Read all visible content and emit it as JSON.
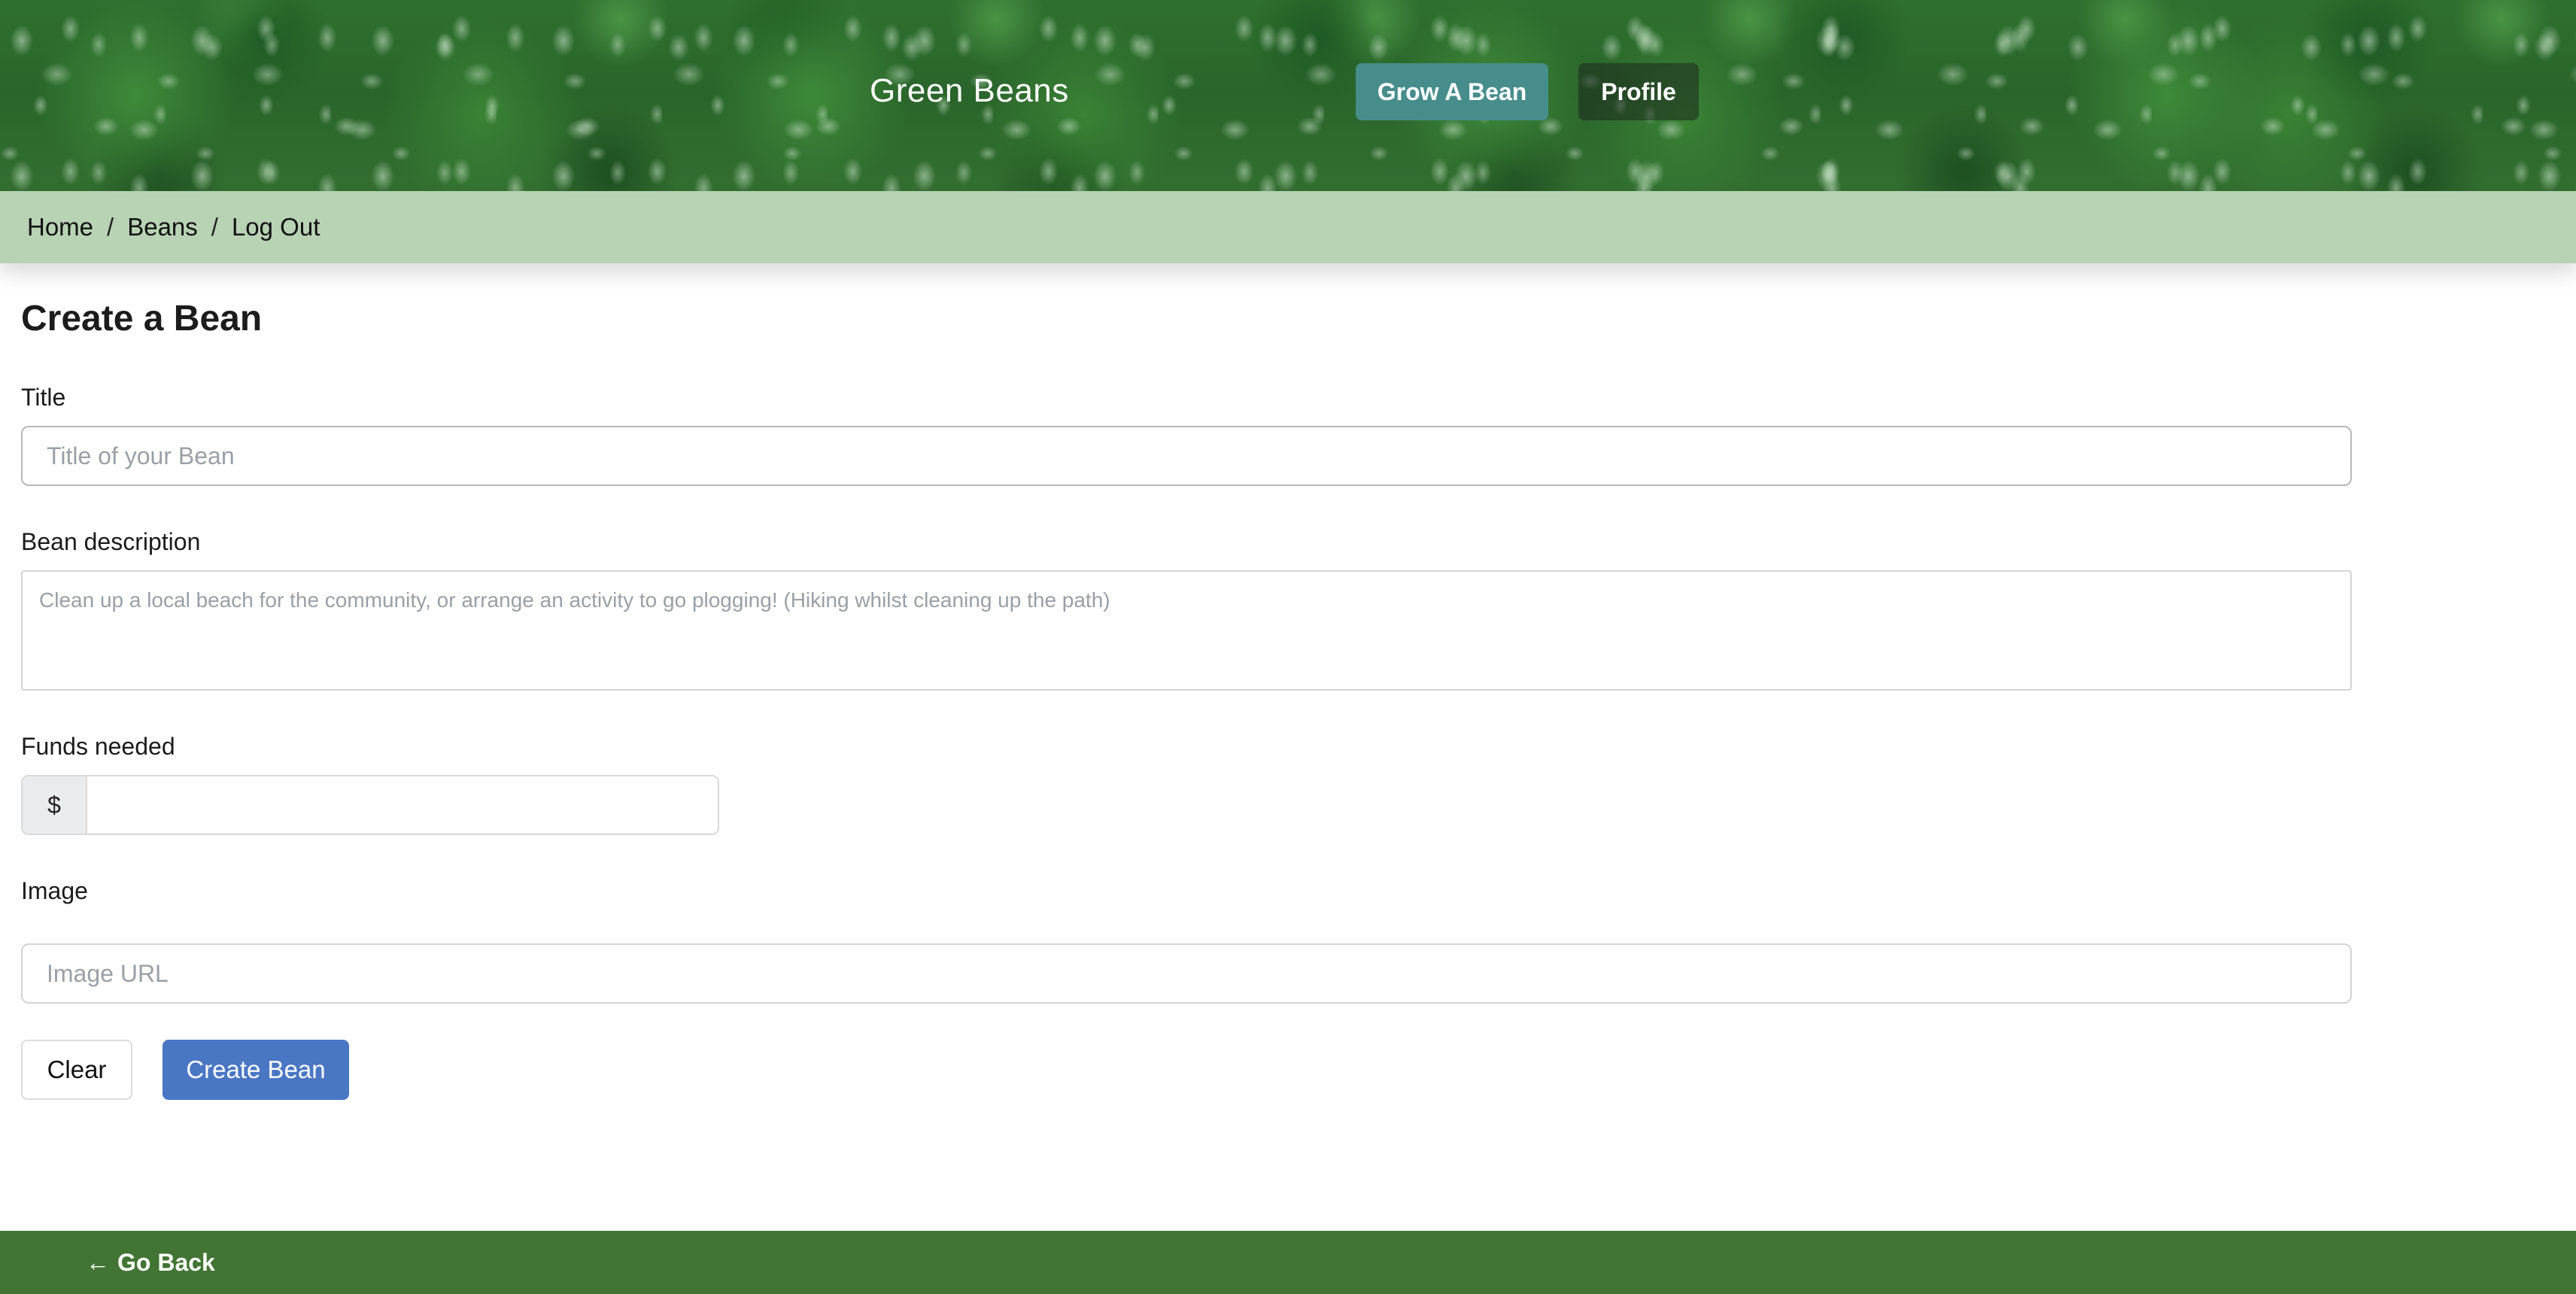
{
  "header": {
    "brand": "Green Beans",
    "nav": {
      "grow_label": "Grow A Bean",
      "profile_label": "Profile"
    }
  },
  "breadcrumb": {
    "items": [
      "Home",
      "Beans",
      "Log Out"
    ],
    "separator": "/"
  },
  "form": {
    "heading": "Create a Bean",
    "title": {
      "label": "Title",
      "placeholder": "Title of your Bean",
      "value": ""
    },
    "description": {
      "label": "Bean description",
      "placeholder": "Clean up a local beach for the community, or arrange an activity to go plogging! (Hiking whilst cleaning up the path)",
      "value": ""
    },
    "funds": {
      "label": "Funds needed",
      "prefix": "$",
      "value": ""
    },
    "image": {
      "label": "Image",
      "placeholder": "Image URL",
      "value": ""
    },
    "buttons": {
      "clear_label": "Clear",
      "create_label": "Create Bean"
    }
  },
  "footer": {
    "back_icon": "arrow-left-icon",
    "back_label": "Go Back"
  },
  "colors": {
    "header_green": "#2c6b2c",
    "breadcrumb_bg": "#b8d2b4",
    "grow_button": "#468d8c",
    "create_button": "#4a77c4",
    "footer_green": "#427533"
  }
}
